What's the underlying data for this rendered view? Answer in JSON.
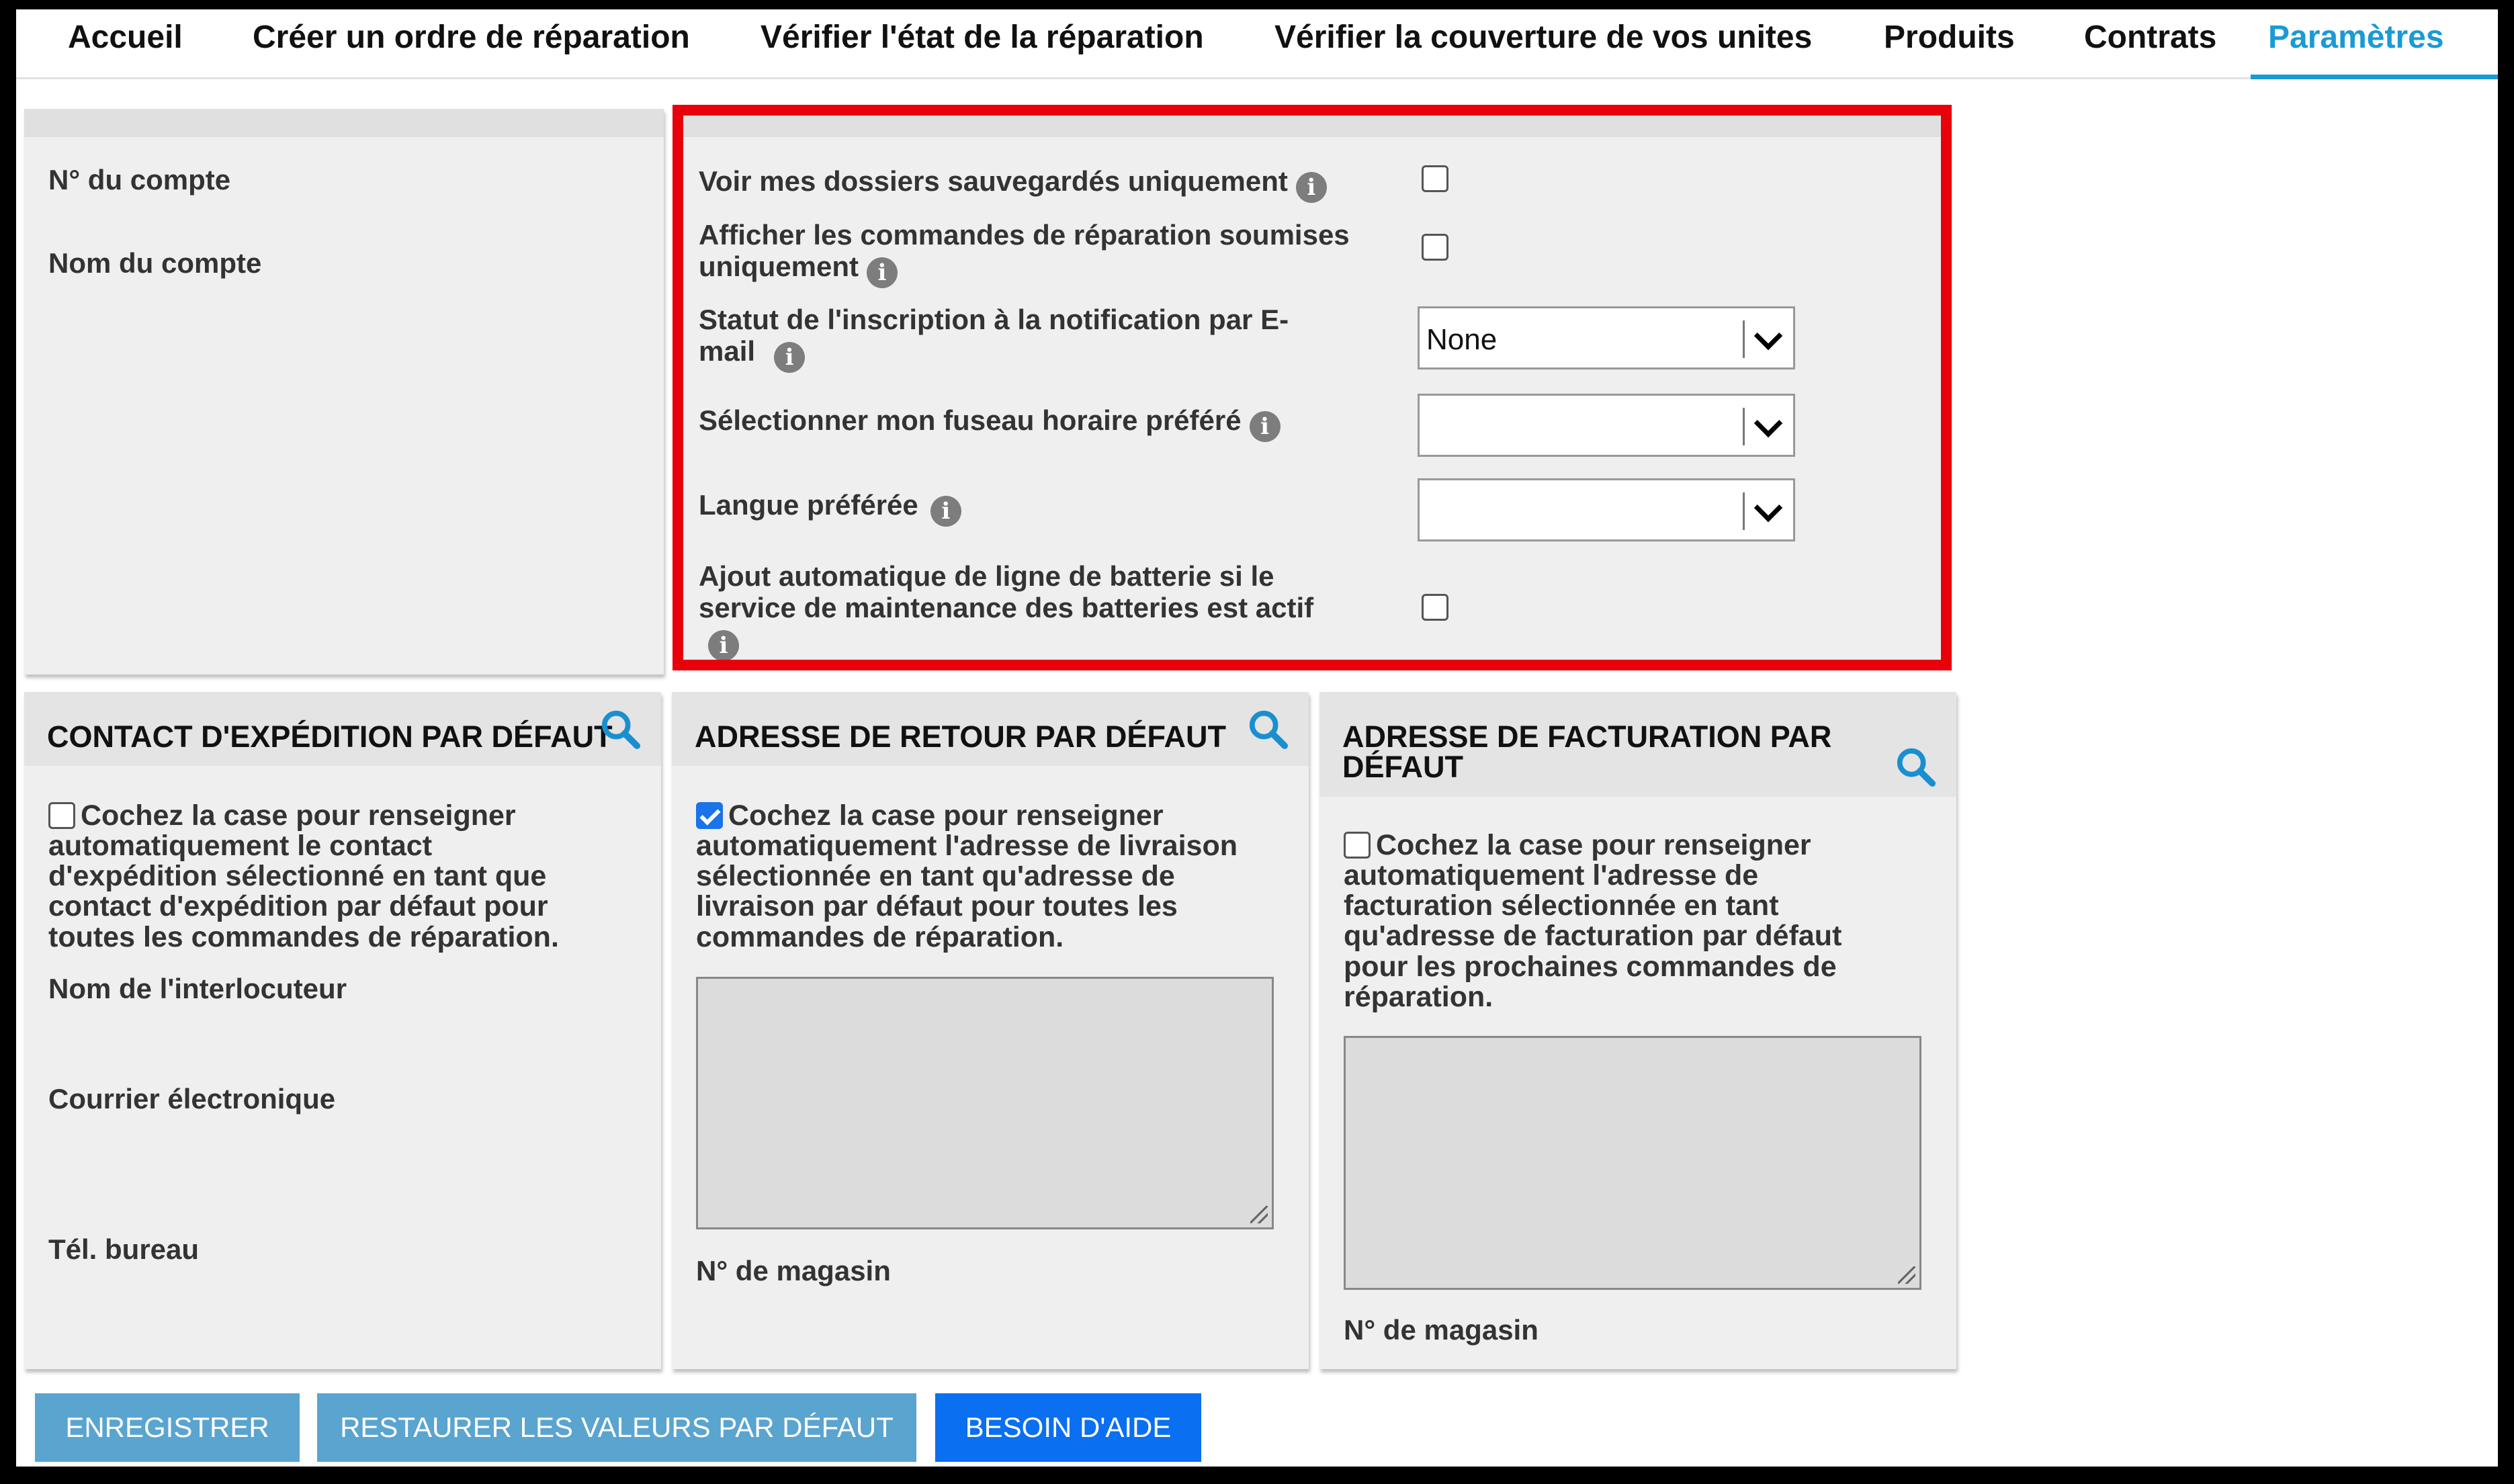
{
  "nav": {
    "tabs": [
      {
        "label": "Accueil"
      },
      {
        "label": "Créer un ordre de réparation"
      },
      {
        "label": "Vérifier l'état de la réparation"
      },
      {
        "label": "Vérifier la couverture de vos unites"
      },
      {
        "label": "Produits"
      },
      {
        "label": "Contrats"
      },
      {
        "label": "Paramètres",
        "active": true
      }
    ]
  },
  "account": {
    "number_label": "N° du compte",
    "name_label": "Nom du compte"
  },
  "settings": {
    "saved_only_label": "Voir mes dossiers sauvegardés uniquement",
    "submitted_only_label_1": "Afficher les commandes de réparation soumises",
    "submitted_only_label_2": "uniquement",
    "email_notif_label_1": "Statut de l'inscription à la notification par E-",
    "email_notif_label_2": "mail",
    "email_notif_value": "None",
    "timezone_label": "Sélectionner mon fuseau horaire préféré",
    "timezone_value": "",
    "language_label": "Langue préférée",
    "language_value": "",
    "battery_label_1": "Ajout automatique de ligne de batterie si le",
    "battery_label_2": "service de maintenance des batteries est actif",
    "saved_only_checked": false,
    "submitted_only_checked": false,
    "battery_checked": false
  },
  "shipping_contact": {
    "title": "CONTACT D'EXPÉDITION PAR DÉFAUT",
    "checkbox_checked": false,
    "checkbox_text": [
      "Cochez la case pour renseigner",
      "automatiquement le contact",
      "d'expédition sélectionné en tant que",
      "contact d'expédition par défaut pour",
      "toutes les commandes de réparation."
    ],
    "contact_name_label": "Nom de l'interlocuteur",
    "email_label": "Courrier électronique",
    "office_phone_label": "Tél. bureau"
  },
  "return_address": {
    "title": "ADRESSE DE RETOUR PAR DÉFAUT",
    "checkbox_checked": true,
    "checkbox_text": [
      "Cochez la case pour renseigner",
      "automatiquement l'adresse de livraison",
      "sélectionnée en tant qu'adresse de",
      "livraison par défaut pour toutes les",
      "commandes de réparation."
    ],
    "store_label": "N° de magasin"
  },
  "billing_address": {
    "title_1": "ADRESSE DE FACTURATION PAR",
    "title_2": "DÉFAUT",
    "checkbox_checked": false,
    "checkbox_text": [
      "Cochez la case pour renseigner",
      "automatiquement l'adresse de",
      "facturation sélectionnée en tant",
      "qu'adresse de facturation par défaut",
      "pour les prochaines commandes de",
      "réparation."
    ],
    "store_label": "N° de magasin"
  },
  "buttons": {
    "save": "ENREGISTRER",
    "restore": "RESTAURER LES VALEURS PAR DÉFAUT",
    "help": "BESOIN D'AIDE"
  },
  "colors": {
    "accent": "#1a9ad6",
    "highlight": "#e8000b",
    "primary_button": "#0a6ff0",
    "muted_button": "#5aa4d0"
  }
}
